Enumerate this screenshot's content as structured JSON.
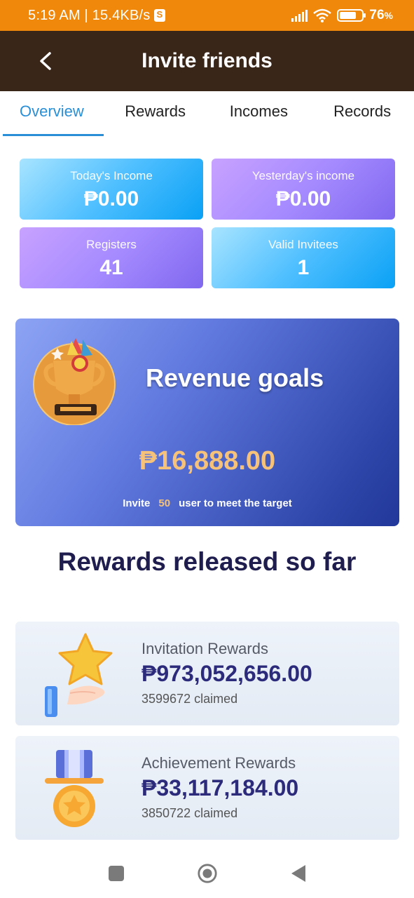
{
  "status_bar": {
    "time_speed": "5:19 AM | 15.4KB/s",
    "battery": "76"
  },
  "header": {
    "title": "Invite friends"
  },
  "tabs": [
    {
      "label": "Overview",
      "active": true
    },
    {
      "label": "Rewards"
    },
    {
      "label": "Incomes"
    },
    {
      "label": "Records"
    }
  ],
  "stats": {
    "today_income": {
      "label": "Today's Income",
      "value": "₱0.00"
    },
    "yesterday_income": {
      "label": "Yesterday's income",
      "value": "₱0.00"
    },
    "registers": {
      "label": "Registers",
      "value": "41"
    },
    "valid_invitees": {
      "label": "Valid Invitees",
      "value": "1"
    }
  },
  "revenue_goal": {
    "title": "Revenue goals",
    "amount": "₱16,888.00",
    "invite_prefix": "Invite",
    "invite_count": "50",
    "invite_suffix": "user to meet the target"
  },
  "rewards_section": {
    "title": "Rewards released so far",
    "items": [
      {
        "title": "Invitation Rewards",
        "amount": "₱973,052,656.00",
        "claimed": "3599672 claimed",
        "icon": "star-hand-icon"
      },
      {
        "title": "Achievement Rewards",
        "amount": "₱33,117,184.00",
        "claimed": "3850722 claimed",
        "icon": "medal-icon"
      }
    ]
  },
  "colors": {
    "status_bar": "#f0880c",
    "header": "#3a2519",
    "tab_active": "#2a8fd6",
    "goal_amount": "#f6c27a",
    "reward_amount": "#2c2a7a"
  }
}
